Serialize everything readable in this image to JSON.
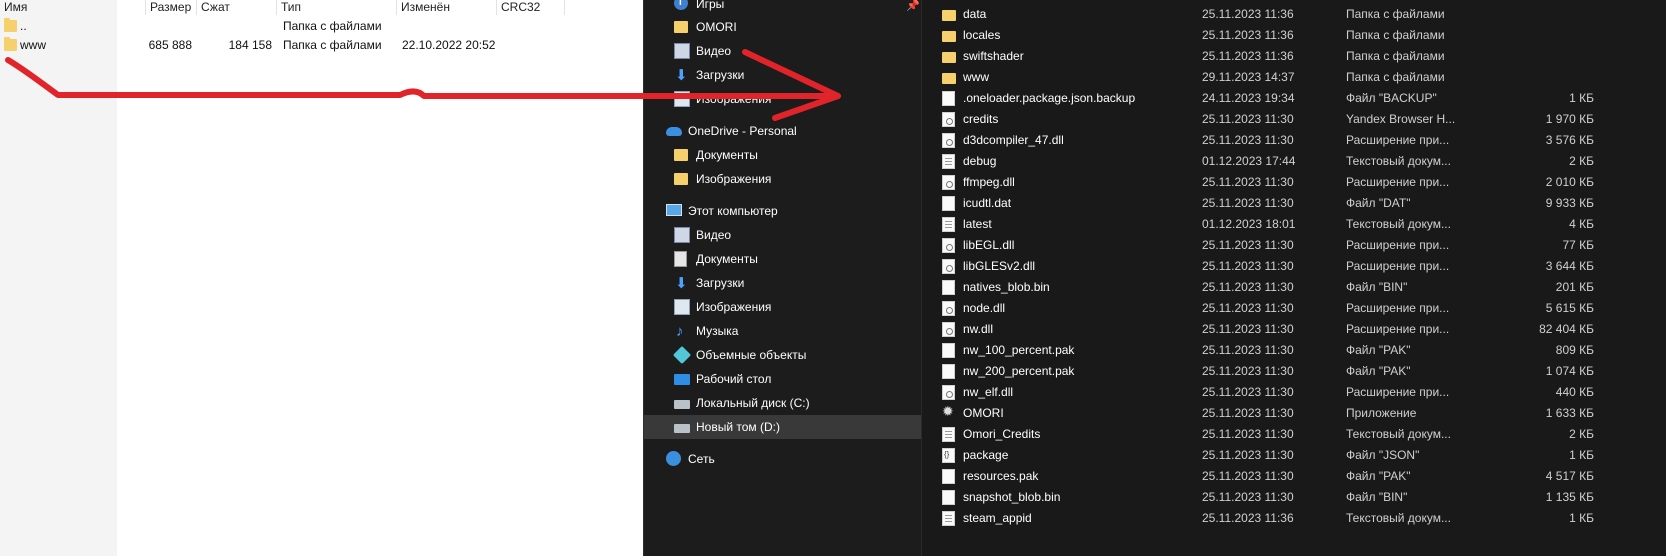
{
  "archive": {
    "columns": [
      "Имя",
      "Размер",
      "Сжат",
      "Тип",
      "Изменён",
      "CRC32"
    ],
    "rows": [
      {
        "name": "..",
        "size": "",
        "packed": "",
        "type": "Папка с файлами",
        "modified": "",
        "crc": ""
      },
      {
        "name": "www",
        "size": "685 888",
        "packed": "184 158",
        "type": "Папка с файлами",
        "modified": "22.10.2022 20:52",
        "crc": ""
      }
    ]
  },
  "nav": {
    "items": [
      {
        "label": "Игры",
        "icon": "games-icon"
      },
      {
        "label": "OMORI",
        "icon": "folder-icon"
      },
      {
        "label": "Видео",
        "icon": "video-icon"
      },
      {
        "label": "Загрузки",
        "icon": "downloads-icon"
      },
      {
        "label": "Изображения",
        "icon": "pictures-icon"
      },
      {
        "label": "OneDrive - Personal",
        "icon": "onedrive-icon"
      },
      {
        "label": "Документы",
        "icon": "folder-icon"
      },
      {
        "label": "Изображения",
        "icon": "folder-icon"
      },
      {
        "label": "Этот компьютер",
        "icon": "this-pc-icon"
      },
      {
        "label": "Видео",
        "icon": "video-icon"
      },
      {
        "label": "Документы",
        "icon": "documents-icon"
      },
      {
        "label": "Загрузки",
        "icon": "downloads-icon"
      },
      {
        "label": "Изображения",
        "icon": "pictures-icon"
      },
      {
        "label": "Музыка",
        "icon": "music-icon"
      },
      {
        "label": "Объемные объекты",
        "icon": "3d-objects-icon"
      },
      {
        "label": "Рабочий стол",
        "icon": "desktop-icon"
      },
      {
        "label": "Локальный диск (C:)",
        "icon": "drive-icon"
      },
      {
        "label": "Новый том (D:)",
        "icon": "drive-icon"
      },
      {
        "label": "Сеть",
        "icon": "network-icon"
      }
    ],
    "selected": "Новый том (D:)"
  },
  "files": [
    {
      "name": "data",
      "date": "25.11.2023 11:36",
      "type": "Папка с файлами",
      "size": "",
      "icon": "folder"
    },
    {
      "name": "locales",
      "date": "25.11.2023 11:36",
      "type": "Папка с файлами",
      "size": "",
      "icon": "folder"
    },
    {
      "name": "swiftshader",
      "date": "25.11.2023 11:36",
      "type": "Папка с файлами",
      "size": "",
      "icon": "folder"
    },
    {
      "name": "www",
      "date": "29.11.2023 14:37",
      "type": "Папка с файлами",
      "size": "",
      "icon": "folder"
    },
    {
      "name": ".oneloader.package.json.backup",
      "date": "24.11.2023 19:34",
      "type": "Файл \"BACKUP\"",
      "size": "1 КБ",
      "icon": "doc"
    },
    {
      "name": "credits",
      "date": "25.11.2023 11:30",
      "type": "Yandex Browser H...",
      "size": "1 970 КБ",
      "icon": "dll"
    },
    {
      "name": "d3dcompiler_47.dll",
      "date": "25.11.2023 11:30",
      "type": "Расширение при...",
      "size": "3 576 КБ",
      "icon": "dll"
    },
    {
      "name": "debug",
      "date": "01.12.2023 17:44",
      "type": "Текстовый докум...",
      "size": "2 КБ",
      "icon": "txt"
    },
    {
      "name": "ffmpeg.dll",
      "date": "25.11.2023 11:30",
      "type": "Расширение при...",
      "size": "2 010 КБ",
      "icon": "dll"
    },
    {
      "name": "icudtl.dat",
      "date": "25.11.2023 11:30",
      "type": "Файл \"DAT\"",
      "size": "9 933 КБ",
      "icon": "doc"
    },
    {
      "name": "latest",
      "date": "01.12.2023 18:01",
      "type": "Текстовый докум...",
      "size": "4 КБ",
      "icon": "txt"
    },
    {
      "name": "libEGL.dll",
      "date": "25.11.2023 11:30",
      "type": "Расширение при...",
      "size": "77 КБ",
      "icon": "dll"
    },
    {
      "name": "libGLESv2.dll",
      "date": "25.11.2023 11:30",
      "type": "Расширение при...",
      "size": "3 644 КБ",
      "icon": "dll"
    },
    {
      "name": "natives_blob.bin",
      "date": "25.11.2023 11:30",
      "type": "Файл \"BIN\"",
      "size": "201 КБ",
      "icon": "doc"
    },
    {
      "name": "node.dll",
      "date": "25.11.2023 11:30",
      "type": "Расширение при...",
      "size": "5 615 КБ",
      "icon": "dll"
    },
    {
      "name": "nw.dll",
      "date": "25.11.2023 11:30",
      "type": "Расширение при...",
      "size": "82 404 КБ",
      "icon": "dll"
    },
    {
      "name": "nw_100_percent.pak",
      "date": "25.11.2023 11:30",
      "type": "Файл \"PAK\"",
      "size": "809 КБ",
      "icon": "doc"
    },
    {
      "name": "nw_200_percent.pak",
      "date": "25.11.2023 11:30",
      "type": "Файл \"PAK\"",
      "size": "1 074 КБ",
      "icon": "doc"
    },
    {
      "name": "nw_elf.dll",
      "date": "25.11.2023 11:30",
      "type": "Расширение при...",
      "size": "440 КБ",
      "icon": "dll"
    },
    {
      "name": "OMORI",
      "date": "25.11.2023 11:30",
      "type": "Приложение",
      "size": "1 633 КБ",
      "icon": "app"
    },
    {
      "name": "Omori_Credits",
      "date": "25.11.2023 11:30",
      "type": "Текстовый докум...",
      "size": "2 КБ",
      "icon": "txt"
    },
    {
      "name": "package",
      "date": "25.11.2023 11:30",
      "type": "Файл \"JSON\"",
      "size": "1 КБ",
      "icon": "json"
    },
    {
      "name": "resources.pak",
      "date": "25.11.2023 11:30",
      "type": "Файл \"PAK\"",
      "size": "4 517 КБ",
      "icon": "doc"
    },
    {
      "name": "snapshot_blob.bin",
      "date": "25.11.2023 11:30",
      "type": "Файл \"BIN\"",
      "size": "1 135 КБ",
      "icon": "doc"
    },
    {
      "name": "steam_appid",
      "date": "25.11.2023 11:36",
      "type": "Текстовый докум...",
      "size": "1 КБ",
      "icon": "txt"
    }
  ],
  "annotation": {
    "color": "#e0242a",
    "icon": "red-arrow-icon"
  }
}
